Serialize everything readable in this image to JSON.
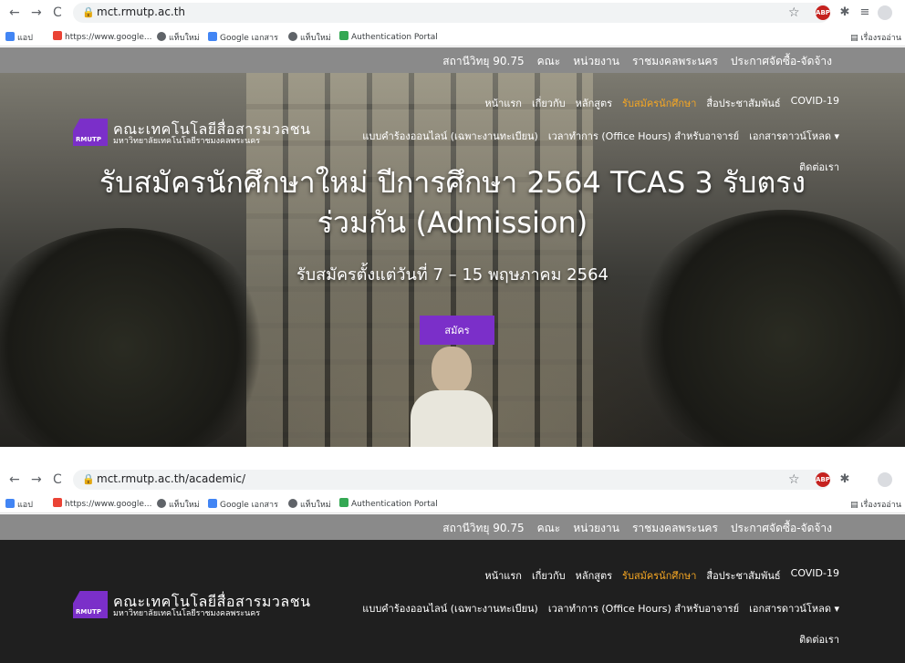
{
  "browser": {
    "shot1_url": "mct.rmutp.ac.th",
    "shot2_url": "mct.rmutp.ac.th/academic/",
    "bookmarks": [
      {
        "label": "แอป",
        "icon": "apps-grid-icon"
      },
      {
        "label": "https://www.google...",
        "icon": "google-icon"
      },
      {
        "label": "แท็บใหม่",
        "icon": "globe-icon"
      },
      {
        "label": "Google เอกสาร",
        "icon": "docs-icon"
      },
      {
        "label": "แท็บใหม่",
        "icon": "globe-icon"
      },
      {
        "label": "Authentication Portal",
        "icon": "portal-icon"
      }
    ],
    "reading_list": "เรื่องรออ่าน",
    "abp_label": "ABP"
  },
  "site": {
    "topbar": [
      "สถานีวิทยุ 90.75",
      "คณะ",
      "หน่วยงาน",
      "ราชมงคลพระนคร",
      "ประกาศจัดซื้อ-จัดจ้าง"
    ],
    "logo_badge": "RMUTP",
    "logo_name": "คณะเทคโนโลยีสื่อสารมวลชน",
    "logo_sub": "มหาวิทยาลัยเทคโนโลยีราชมงคลพระนคร",
    "nav_row1": [
      "หน้าแรก",
      "เกี่ยวกับ",
      "หลักสูตร",
      "รับสมัครนักศึกษา",
      "สื่อประชาสัมพันธ์",
      "COVID-19"
    ],
    "nav_row1_active_index": 3,
    "nav_row2": [
      "แบบคำร้องออนไลน์ (เฉพาะงานทะเบียน)",
      "เวลาทำการ (Office Hours) สำหรับอาจารย์",
      "เอกสารดาวน์โหลด ▾"
    ],
    "nav_contact": "ติดต่อเรา",
    "hero_title_line1": "รับสมัครนักศึกษาใหม่ ปีการศึกษา 2564 TCAS 3 รับตรง",
    "hero_title_line2": "ร่วมกัน (Admission)",
    "hero_subtitle": "รับสมัครตั้งแต่วันที่ 7 – 15 พฤษภาคม 2564",
    "apply_button": "สมัคร"
  },
  "colors": {
    "accent_purple": "#7b2fc9",
    "active_nav": "#f5a623",
    "topbar_gray": "#8a8a8a"
  }
}
